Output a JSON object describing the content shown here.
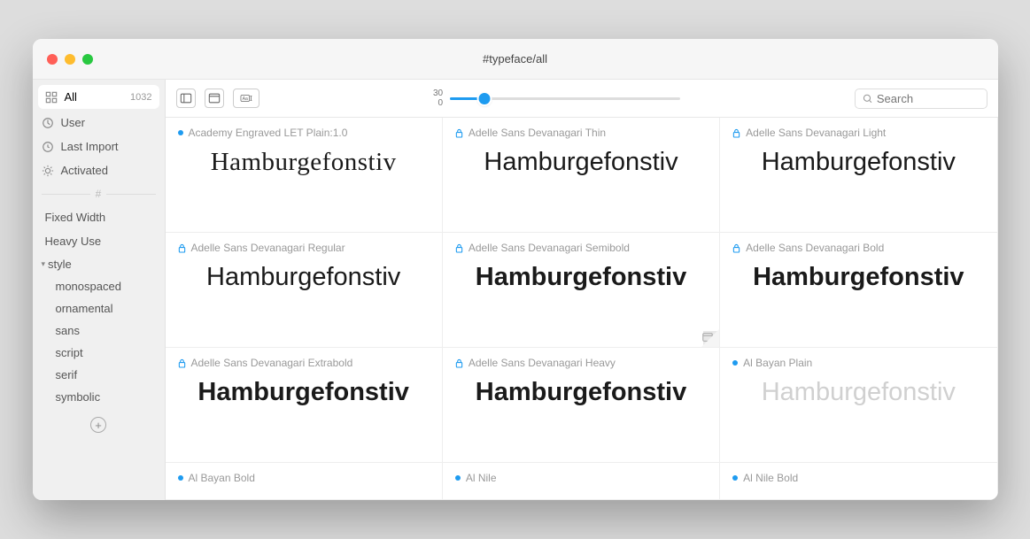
{
  "header": {
    "title": "#typeface/all"
  },
  "sidebar": {
    "all": {
      "label": "All",
      "count": "1032"
    },
    "user": {
      "label": "User"
    },
    "last_import": {
      "label": "Last Import"
    },
    "activated": {
      "label": "Activated"
    },
    "tag_sep": "#",
    "fixed_width": {
      "label": "Fixed Width"
    },
    "heavy_use": {
      "label": "Heavy Use"
    },
    "style_group": {
      "label": "style"
    },
    "style_items": {
      "monospaced": "monospaced",
      "ornamental": "ornamental",
      "sans": "sans",
      "script": "script",
      "serif": "serif",
      "symbolic": "symbolic"
    }
  },
  "toolbar": {
    "slider": {
      "top": "30",
      "bottom": "0"
    },
    "search_placeholder": "Search"
  },
  "preview_word": "Hamburgefonstiv",
  "fonts": [
    {
      "name": "Academy Engraved LET Plain:1.0",
      "status": "dot",
      "cls": "serif-eng"
    },
    {
      "name": "Adelle Sans Devanagari Thin",
      "status": "lock",
      "cls": "thin"
    },
    {
      "name": "Adelle Sans Devanagari Light",
      "status": "lock",
      "cls": "light"
    },
    {
      "name": "Adelle Sans Devanagari Regular",
      "status": "lock",
      "cls": "regular"
    },
    {
      "name": "Adelle Sans Devanagari Semibold",
      "status": "lock",
      "cls": "semibold",
      "corner": true
    },
    {
      "name": "Adelle Sans Devanagari Bold",
      "status": "lock",
      "cls": "bold"
    },
    {
      "name": "Adelle Sans Devanagari Extrabold",
      "status": "lock",
      "cls": "extrabold"
    },
    {
      "name": "Adelle Sans Devanagari Heavy",
      "status": "lock",
      "cls": "heavy"
    },
    {
      "name": "Al Bayan Plain",
      "status": "dot",
      "cls": "faded"
    },
    {
      "name": "Al Bayan Bold",
      "status": "dot",
      "cls": "",
      "nopreview": true
    },
    {
      "name": "Al Nile",
      "status": "dot",
      "cls": "",
      "nopreview": true
    },
    {
      "name": "Al Nile Bold",
      "status": "dot",
      "cls": "",
      "nopreview": true
    }
  ]
}
